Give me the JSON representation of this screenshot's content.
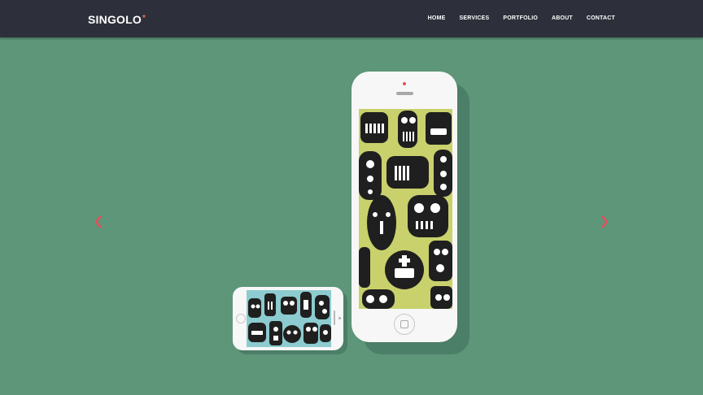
{
  "header": {
    "logo_text": "SINGOLO",
    "logo_mark": "*",
    "nav": [
      "HOME",
      "SERVICES",
      "PORTFOLIO",
      "ABOUT",
      "CONTACT"
    ]
  },
  "slider": {
    "prev_icon": "chevron-left-icon",
    "next_icon": "chevron-right-icon",
    "arrow_color": "#e0515a",
    "background_color": "#5d9679"
  },
  "phones": {
    "vertical_screen_color": "#c9d16d",
    "horizontal_screen_color": "#8ccbcf",
    "screen_art": "robot-monsters-pattern"
  },
  "colors": {
    "header_bg": "#2d303a",
    "accent": "#f06c64",
    "monster": "#1f1f1f"
  }
}
